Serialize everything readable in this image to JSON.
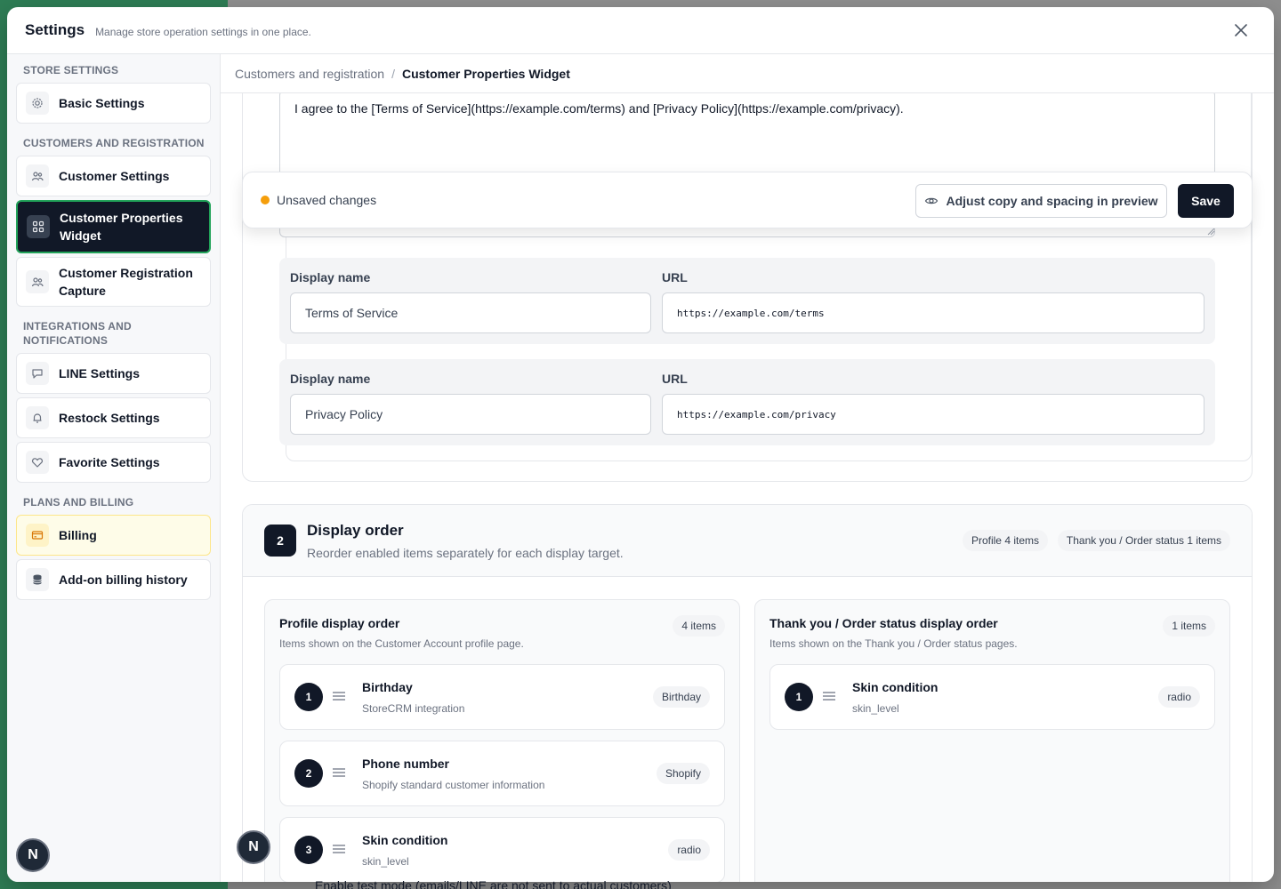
{
  "modal": {
    "title": "Settings",
    "subtitle": "Manage store operation settings in one place."
  },
  "sidebar": {
    "sections": [
      {
        "title": "STORE SETTINGS"
      },
      {
        "title": "CUSTOMERS AND REGISTRATION"
      },
      {
        "title": "INTEGRATIONS AND NOTIFICATIONS"
      },
      {
        "title": "PLANS AND BILLING"
      }
    ],
    "items": [
      {
        "label": "Basic Settings",
        "icon": "gear-icon"
      },
      {
        "label": "Customer Settings",
        "icon": "users-icon"
      },
      {
        "label": "Customer Properties Widget",
        "icon": "grid-icon",
        "active": true
      },
      {
        "label": "Customer Registration Capture",
        "icon": "users-icon"
      },
      {
        "label": "LINE Settings",
        "icon": "chat-icon"
      },
      {
        "label": "Restock Settings",
        "icon": "bell-icon"
      },
      {
        "label": "Favorite Settings",
        "icon": "heart-icon"
      },
      {
        "label": "Billing",
        "icon": "credit-card-icon"
      },
      {
        "label": "Add-on billing history",
        "icon": "database-icon"
      }
    ]
  },
  "breadcrumb": {
    "parent": "Customers and registration",
    "separator": "/",
    "current": "Customer Properties Widget"
  },
  "consent": {
    "text": "I agree to the [Terms of Service](https://example.com/terms) and [Privacy Policy](https://example.com/privacy).",
    "links": [
      {
        "name_label": "Display name",
        "url_label": "URL",
        "name": "Terms of Service",
        "url": "https://example.com/terms"
      },
      {
        "name_label": "Display name",
        "url_label": "URL",
        "name": "Privacy Policy",
        "url": "https://example.com/privacy"
      }
    ]
  },
  "savebar": {
    "status": "Unsaved changes",
    "preview_label": "Adjust copy and spacing in preview",
    "save_label": "Save",
    "status_color": "#f59e0b"
  },
  "display_order": {
    "step": "2",
    "title": "Display order",
    "subtitle": "Reorder enabled items separately for each display target.",
    "profile_pill": "Profile 4 items",
    "thanks_pill": "Thank you / Order status 1 items",
    "profile": {
      "title": "Profile display order",
      "subtitle": "Items shown on the Customer Account profile page.",
      "count": "4 items",
      "rows": [
        {
          "num": "1",
          "title": "Birthday",
          "sub": "StoreCRM integration",
          "tag": "Birthday"
        },
        {
          "num": "2",
          "title": "Phone number",
          "sub": "Shopify standard customer information",
          "tag": "Shopify"
        },
        {
          "num": "3",
          "title": "Skin condition",
          "sub": "skin_level",
          "tag": "radio"
        }
      ]
    },
    "thanks": {
      "title": "Thank you / Order status display order",
      "subtitle": "Items shown on the Thank you / Order status pages.",
      "count": "1 items",
      "rows": [
        {
          "num": "1",
          "title": "Skin condition",
          "sub": "skin_level",
          "tag": "radio"
        }
      ]
    }
  },
  "partial_text": "Enable test mode (emails/LINE are not sent to actual customers)",
  "avatar_letter": "N"
}
